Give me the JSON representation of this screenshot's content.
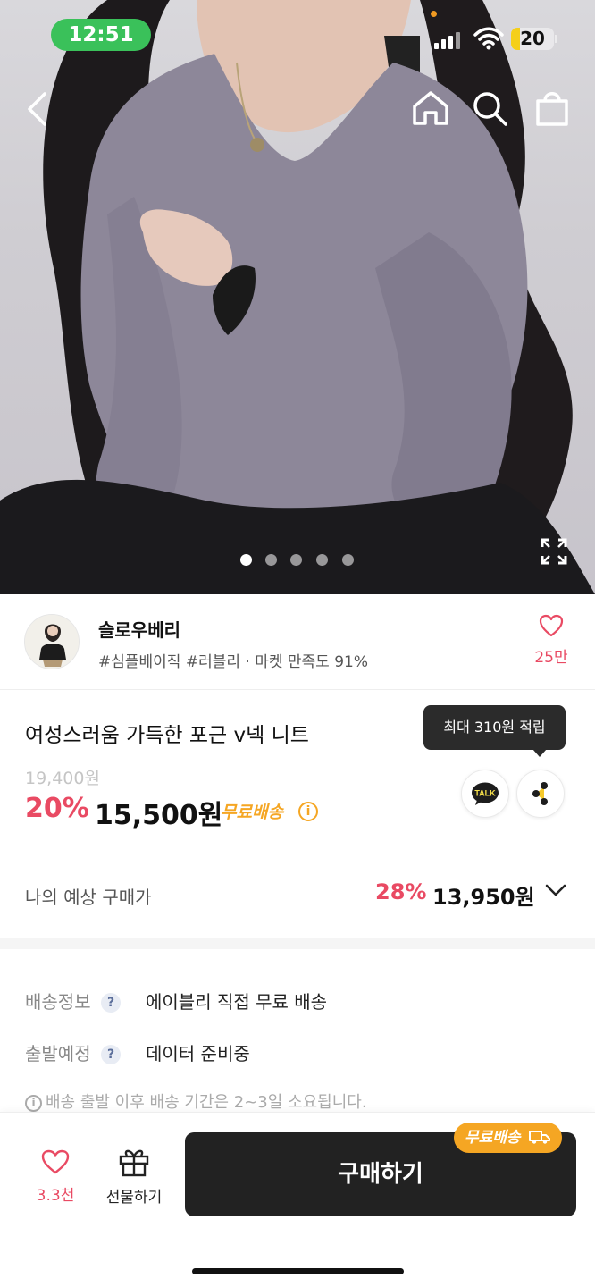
{
  "status_bar": {
    "time": "12:51",
    "battery": "20",
    "battery_level": 0.2
  },
  "hero": {
    "nav": {
      "back_icon": "chevron-left-icon",
      "home_icon": "home-icon",
      "search_icon": "search-icon",
      "bag_icon": "shopping-bag-icon",
      "expand_icon": "expand-icon"
    },
    "carousel": {
      "count": 5,
      "active_index": 0
    }
  },
  "seller": {
    "name": "슬로우베리",
    "tags": "#심플베이직 #러블리 · 마켓 만족도 91%",
    "likes": "25만"
  },
  "product": {
    "title": "여성스러움 가득한 포근 v넥 니트",
    "tooltip": "최대 310원 적립",
    "original_price": "19,400원",
    "discount": "20%",
    "price": "15,500원",
    "free_shipping": "무료배송",
    "talk_label": "TALK"
  },
  "expected_price": {
    "label": "나의 예상 구매가",
    "discount": "28%",
    "price": "13,950원"
  },
  "shipping": {
    "rows": [
      {
        "label": "배송정보",
        "value": "에이블리 직접 무료 배송"
      },
      {
        "label": "출발예정",
        "value": "데이터 준비중"
      }
    ],
    "note": "배송 출발 이후 배송 기간은 2~3일 소요됩니다."
  },
  "bottom_bar": {
    "wish_count": "3.3천",
    "gift_label": "선물하기",
    "buy_label": "구매하기",
    "free_badge": "무료배송"
  },
  "colors": {
    "accent_red": "#e94a63",
    "accent_orange": "#f5a623",
    "status_green": "#3ac15a",
    "dark": "#222222"
  }
}
